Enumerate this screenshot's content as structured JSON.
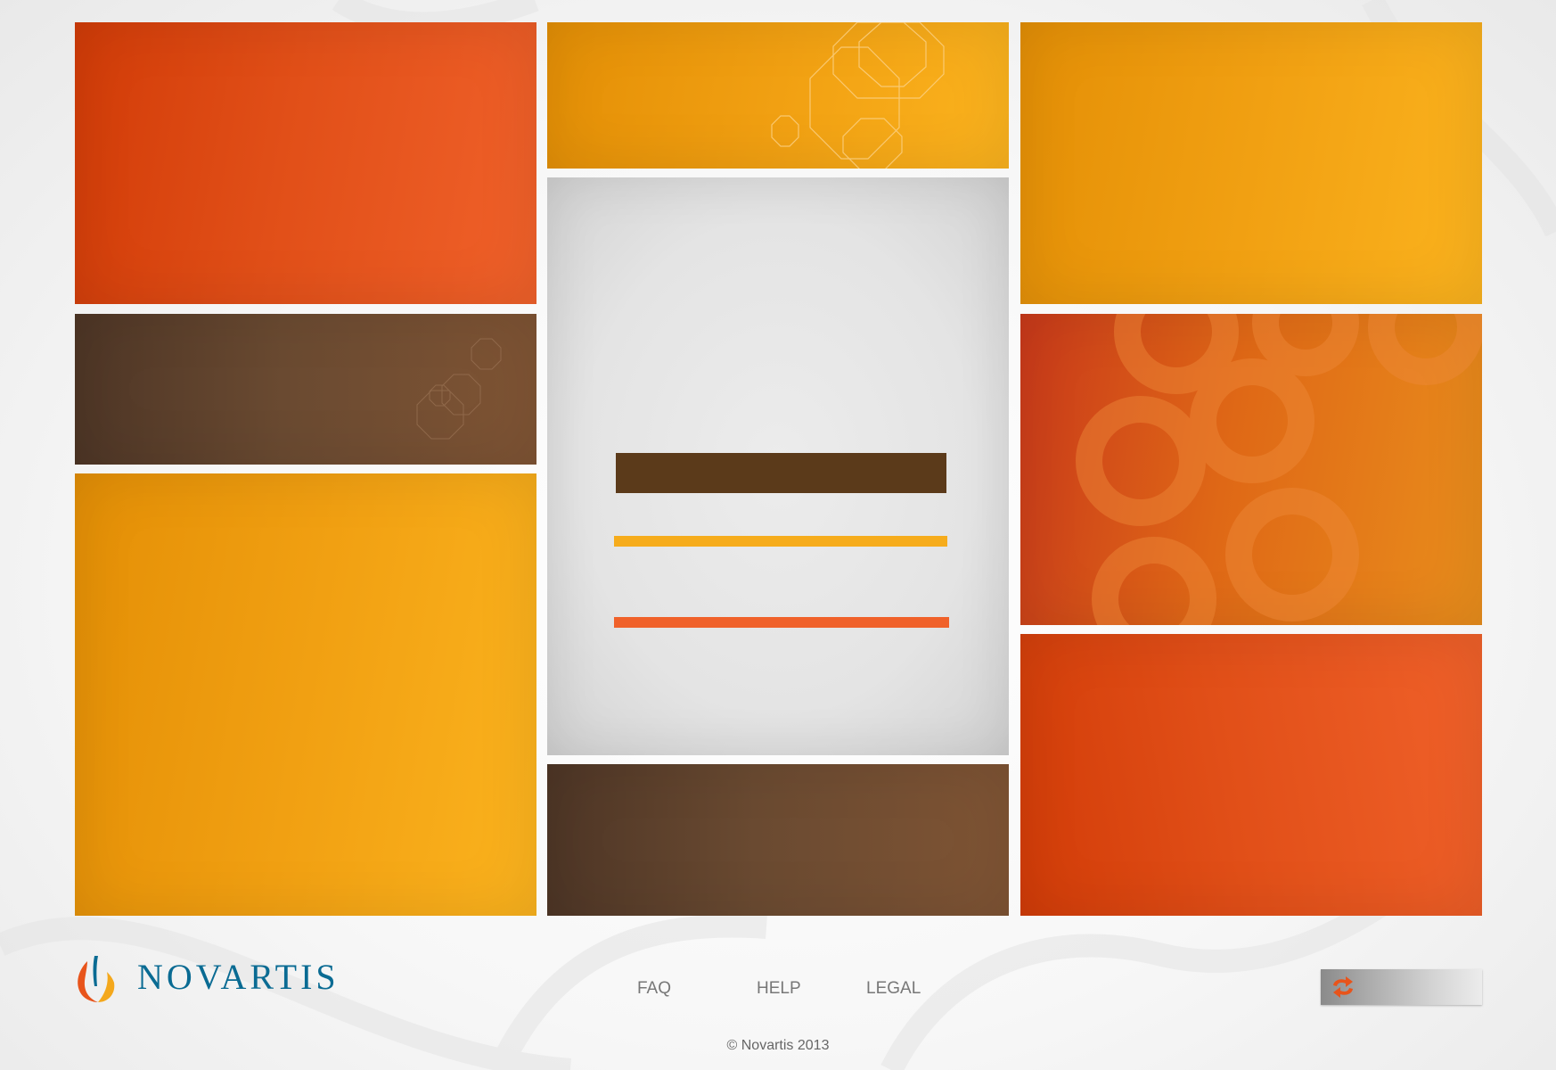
{
  "brand": {
    "name": "NOVARTIS",
    "colors": {
      "red": "#e14f18",
      "yellow": "#f1a012",
      "brown": "#6a4a31",
      "orange_bar": "#f0612a",
      "yellow_bar": "#f6ac1c",
      "brown_bar": "#5b3a1a",
      "logo_blue": "#0a6b93"
    }
  },
  "tiles": {
    "left": [
      "red",
      "brown",
      "yellow"
    ],
    "center": [
      "yellow",
      "gray-panel",
      "brown"
    ],
    "right": [
      "yellow",
      "orange-pattern",
      "red"
    ]
  },
  "footer": {
    "links": {
      "faq": "FAQ",
      "help": "HELP",
      "legal": "LEGAL"
    },
    "copyright": "© Novartis 2013",
    "refresh_icon": "refresh-arrows-icon"
  }
}
